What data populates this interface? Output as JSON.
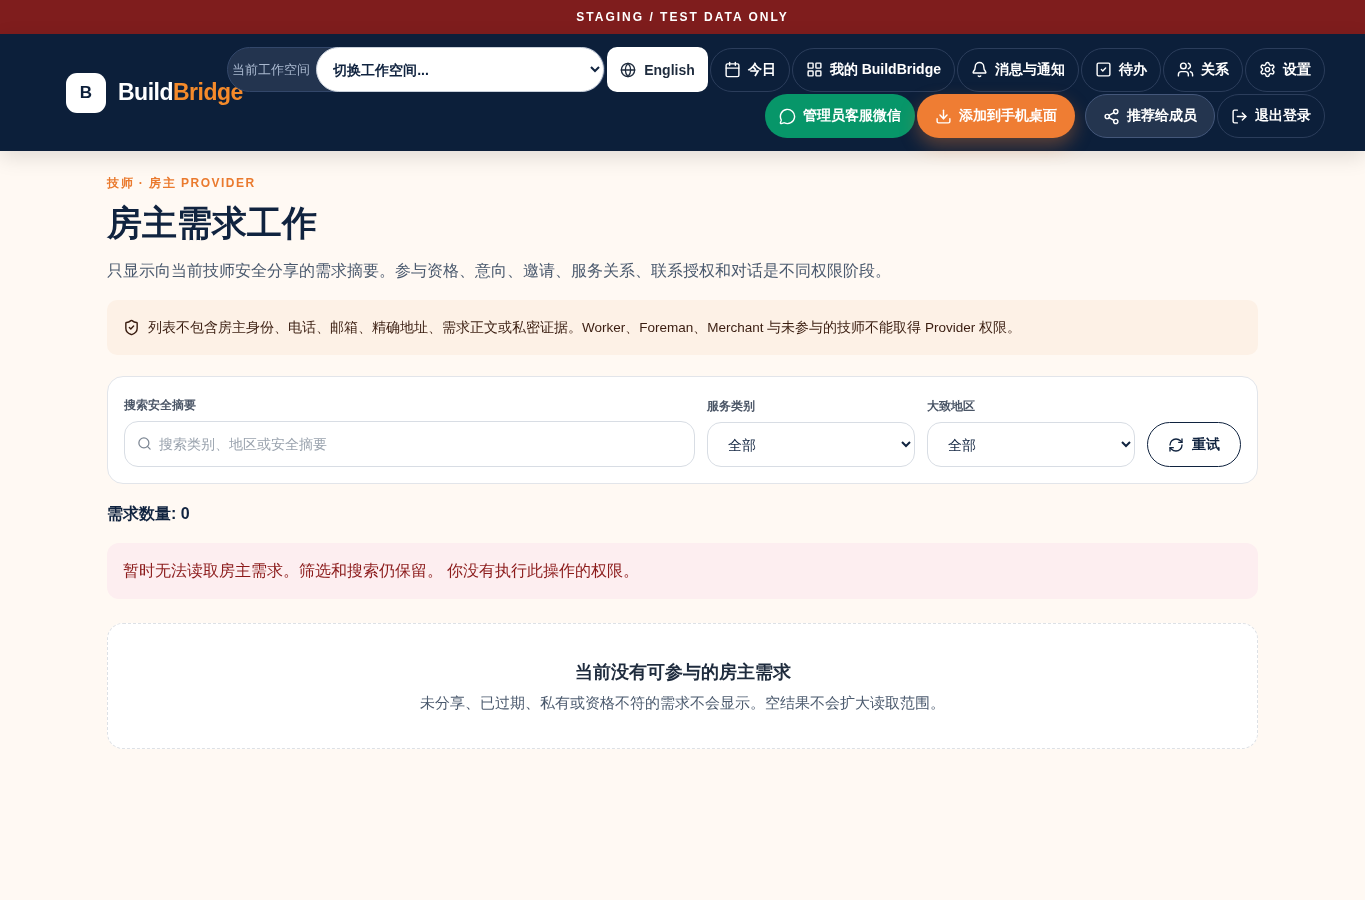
{
  "banner": "STAGING / TEST DATA ONLY",
  "logo": {
    "mark": "B",
    "name_first": "Build",
    "name_second": "Bridge"
  },
  "workspace": {
    "label": "当前工作空间",
    "select_value": "切换工作空间..."
  },
  "language": {
    "label": "English"
  },
  "nav_links": [
    {
      "label": "今日"
    },
    {
      "label": "我的 BuildBridge"
    },
    {
      "label": "消息与通知"
    },
    {
      "label": "待办"
    },
    {
      "label": "关系"
    },
    {
      "label": "设置"
    }
  ],
  "actions": [
    {
      "label": "管理员客服微信",
      "kind": "green"
    },
    {
      "label": "添加到手机桌面",
      "kind": "orange"
    },
    {
      "label": "推荐给成员",
      "kind": "dark"
    },
    {
      "label": "退出登录",
      "kind": "plain"
    }
  ],
  "page": {
    "eyebrow": "技师 · 房主 PROVIDER",
    "title": "房主需求工作",
    "description": "只显示向当前技师安全分享的需求摘要。参与资格、意向、邀请、服务关系、联系授权和对话是不同权限阶段。"
  },
  "notice": "列表不包含房主身份、电话、邮箱、精确地址、需求正文或私密证据。Worker、Foreman、Merchant 与未参与的技师不能取得 Provider 权限。",
  "filters": {
    "search": {
      "label": "搜索安全摘要",
      "placeholder": "搜索类别、地区或安全摘要"
    },
    "category": {
      "label": "服务类别",
      "value": "全部"
    },
    "region": {
      "label": "大致地区",
      "value": "全部"
    },
    "reset": "重试"
  },
  "count": "需求数量: 0",
  "error": "暂时无法读取房主需求。筛选和搜索仍保留。 你没有执行此操作的权限。",
  "empty": {
    "title": "当前没有可参与的房主需求",
    "text": "未分享、已过期、私有或资格不符的需求不会显示。空结果不会扩大读取范围。"
  }
}
